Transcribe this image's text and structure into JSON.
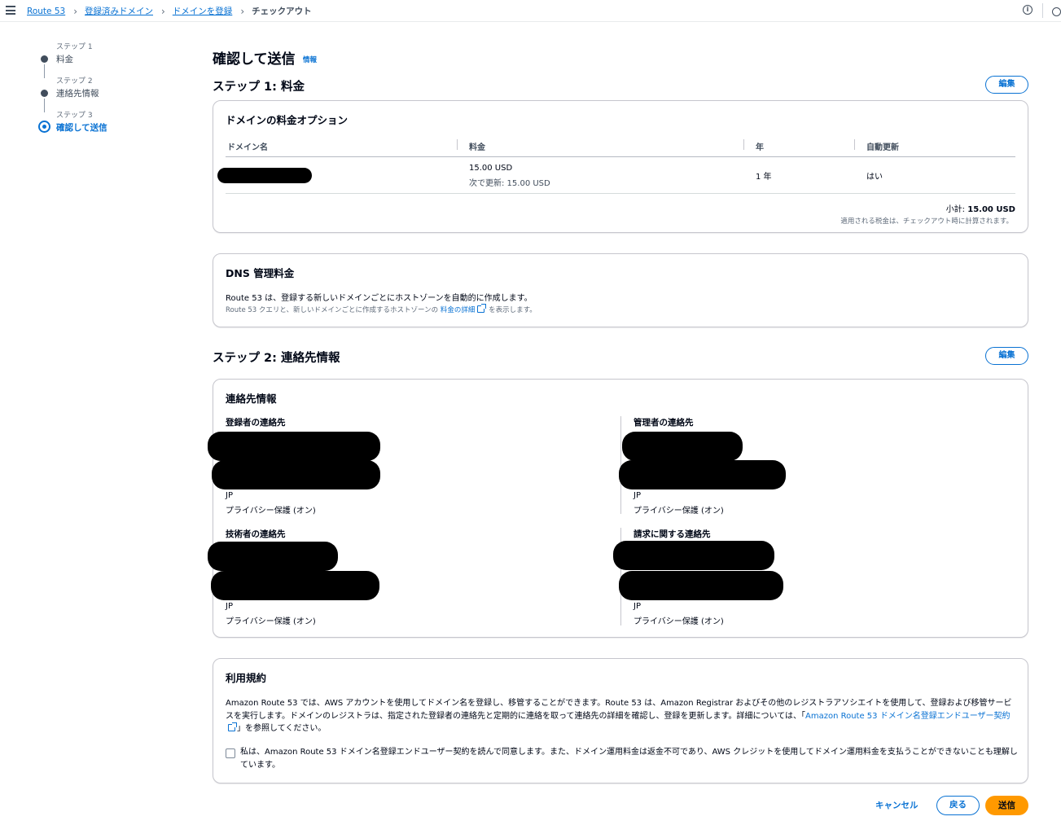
{
  "breadcrumb": {
    "items": [
      "Route 53",
      "登録済みドメイン",
      "ドメインを登録"
    ],
    "current": "チェックアウト"
  },
  "topbar": {
    "info_icon": "i"
  },
  "wizard": {
    "steps": [
      {
        "kicker": "ステップ 1",
        "label": "料金"
      },
      {
        "kicker": "ステップ 2",
        "label": "連絡先情報"
      },
      {
        "kicker": "ステップ 3",
        "label": "確認して送信"
      }
    ],
    "active_step": 3
  },
  "page": {
    "title": "確認して送信",
    "info_link": "情報"
  },
  "step1": {
    "title": "ステップ 1: 料金",
    "edit_label": "編集",
    "pricing_card": {
      "title": "ドメインの料金オプション",
      "columns": [
        "ドメイン名",
        "料金",
        "年",
        "自動更新"
      ],
      "row": {
        "domain": "",
        "price": "15.00 USD",
        "renewal": "次で更新: 15.00 USD",
        "years": "1 年",
        "auto_renew": "はい"
      },
      "subtotal_label": "小計:",
      "subtotal_value": "15.00 USD",
      "tax_note": "適用される税金は、チェックアウト時に計算されます。"
    },
    "dns_card": {
      "title": "DNS 管理料金",
      "line1": "Route 53 は、登録する新しいドメインごとにホストゾーンを自動的に作成します。",
      "line2_prefix": "Route 53 クエリと、新しいドメインごとに作成するホストゾーンの",
      "line2_link": "料金の詳細",
      "line2_suffix": "を表示します。"
    }
  },
  "step2": {
    "title": "ステップ 2: 連絡先情報",
    "edit_label": "編集",
    "card_title": "連絡先情報",
    "contacts": [
      {
        "heading": "登録者の連絡先",
        "country": "JP",
        "privacy": "プライバシー保護 (オン)"
      },
      {
        "heading": "管理者の連絡先",
        "country": "JP",
        "privacy": "プライバシー保護 (オン)"
      },
      {
        "heading": "技術者の連絡先",
        "country": "JP",
        "privacy": "プライバシー保護 (オン)"
      },
      {
        "heading": "請求に関する連絡先",
        "country": "JP",
        "privacy": "プライバシー保護 (オン)"
      }
    ]
  },
  "terms": {
    "title": "利用規約",
    "body_prefix": "Amazon Route 53 では、AWS アカウントを使用してドメイン名を登録し、移管することができます。Route 53 は、Amazon Registrar およびその他のレジストラアソシエイトを使用して、登録および移管サービスを実行します。ドメインのレジストラは、指定された登録者の連絡先と定期的に連絡を取って連絡先の詳細を確認し、登録を更新します。詳細については、「",
    "body_link": "Amazon Route 53 ドメイン名登録エンドユーザー契約",
    "body_suffix": "」を参照してください。",
    "agree_text": "私は、Amazon Route 53 ドメイン名登録エンドユーザー契約を読んで同意します。また、ドメイン運用料金は返金不可であり、AWS クレジットを使用してドメイン運用料金を支払うことができないことも理解しています。",
    "agreed": false
  },
  "footer": {
    "cancel": "キャンセル",
    "back": "戻る",
    "submit": "送信"
  },
  "colors": {
    "link": "#0972d3",
    "primary_button": "#ff9900",
    "text": "#000716",
    "border": "#c6c6cd"
  }
}
